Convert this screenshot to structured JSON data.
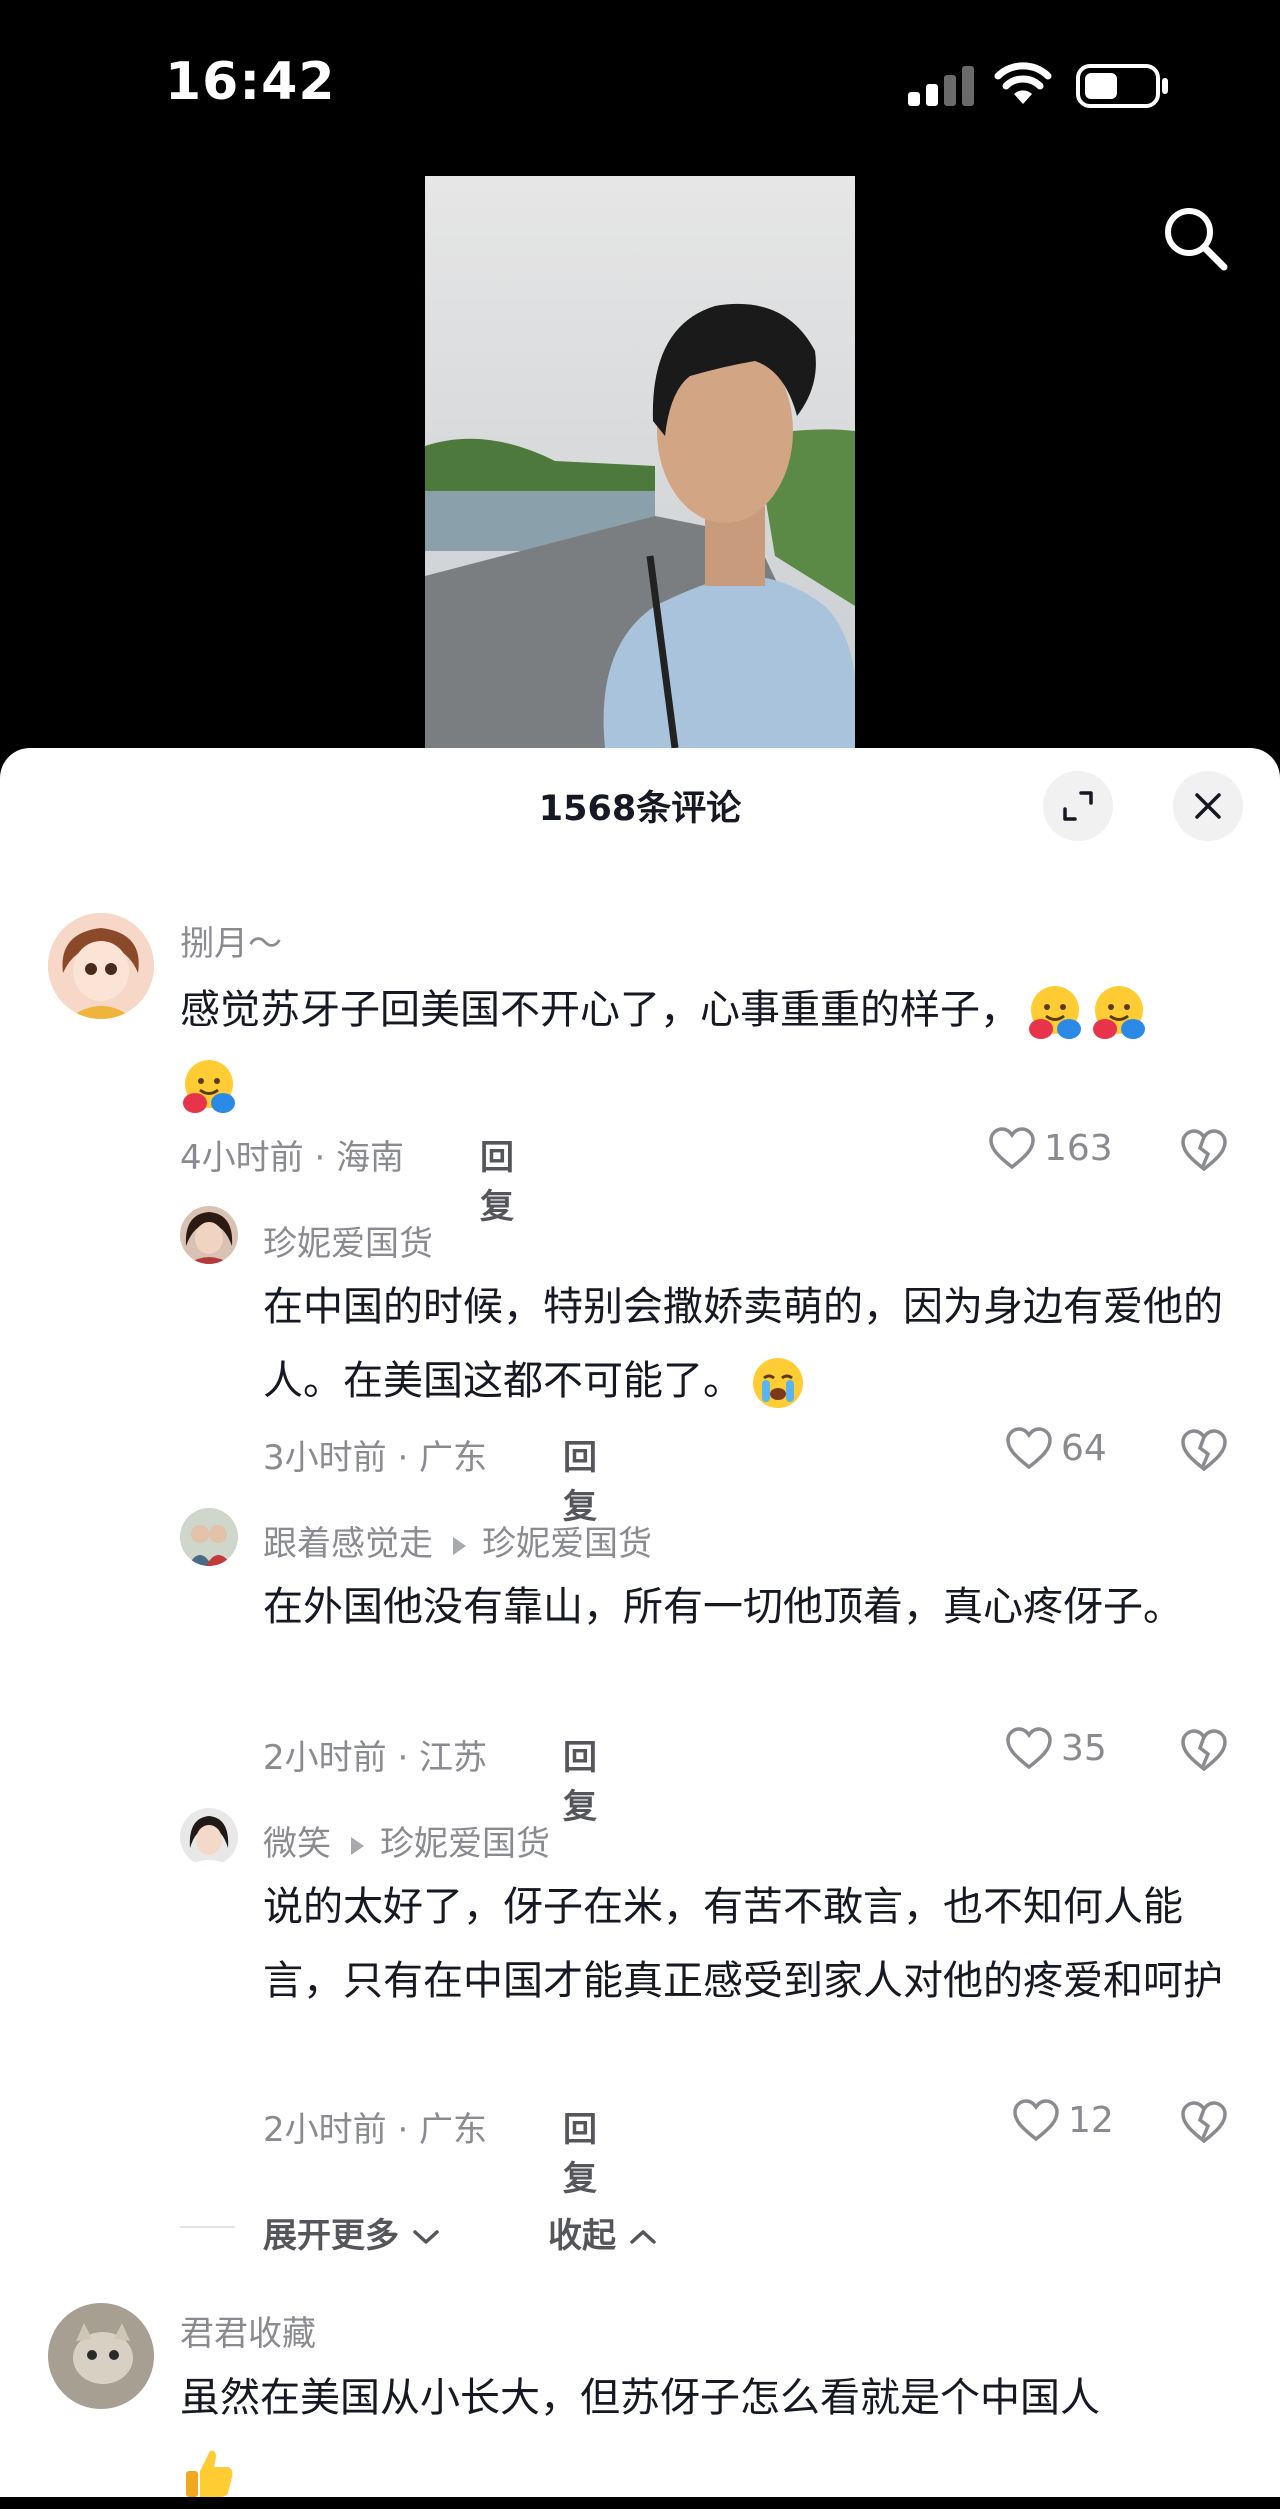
{
  "status_bar": {
    "time": "16:42"
  },
  "sheet": {
    "title": "1568条评论"
  },
  "comments": [
    {
      "user": "捌月～",
      "text": "感觉苏牙子回美国不开心了，心事重重的样子，",
      "meta": "4小时前 · 海南",
      "reply_label": "回复",
      "likes": "163"
    },
    {
      "user": "珍妮爱国货",
      "text": "在中国的时候，特别会撒娇卖萌的，因为身边有爱他的人。在美国这都不可能了。",
      "meta": "3小时前 · 广东",
      "reply_label": "回复",
      "likes": "64"
    },
    {
      "user": "跟着感觉走",
      "reply_to": "珍妮爱国货",
      "text": "在外国他没有靠山，所有一切他顶着，真心疼伢子。",
      "meta": "2小时前 · 江苏",
      "reply_label": "回复",
      "likes": "35"
    },
    {
      "user": "微笑",
      "reply_to": "珍妮爱国货",
      "text": "说的太好了，伢子在米，有苦不敢言，也不知何人能言，只有在中国才能真正感受到家人对他的疼爱和呵护",
      "meta": "2小时前 · 广东",
      "reply_label": "回复",
      "likes": "12"
    },
    {
      "user": "君君收藏",
      "text": "虽然在美国从小长大，但苏伢子怎么看就是个中国人"
    }
  ],
  "expand": {
    "more": "展开更多",
    "collapse": "收起"
  },
  "icons": {
    "search": "search-icon",
    "expand": "expand-icon",
    "close": "close-icon",
    "like": "heart-outline-icon",
    "dislike": "broken-heart-icon"
  }
}
